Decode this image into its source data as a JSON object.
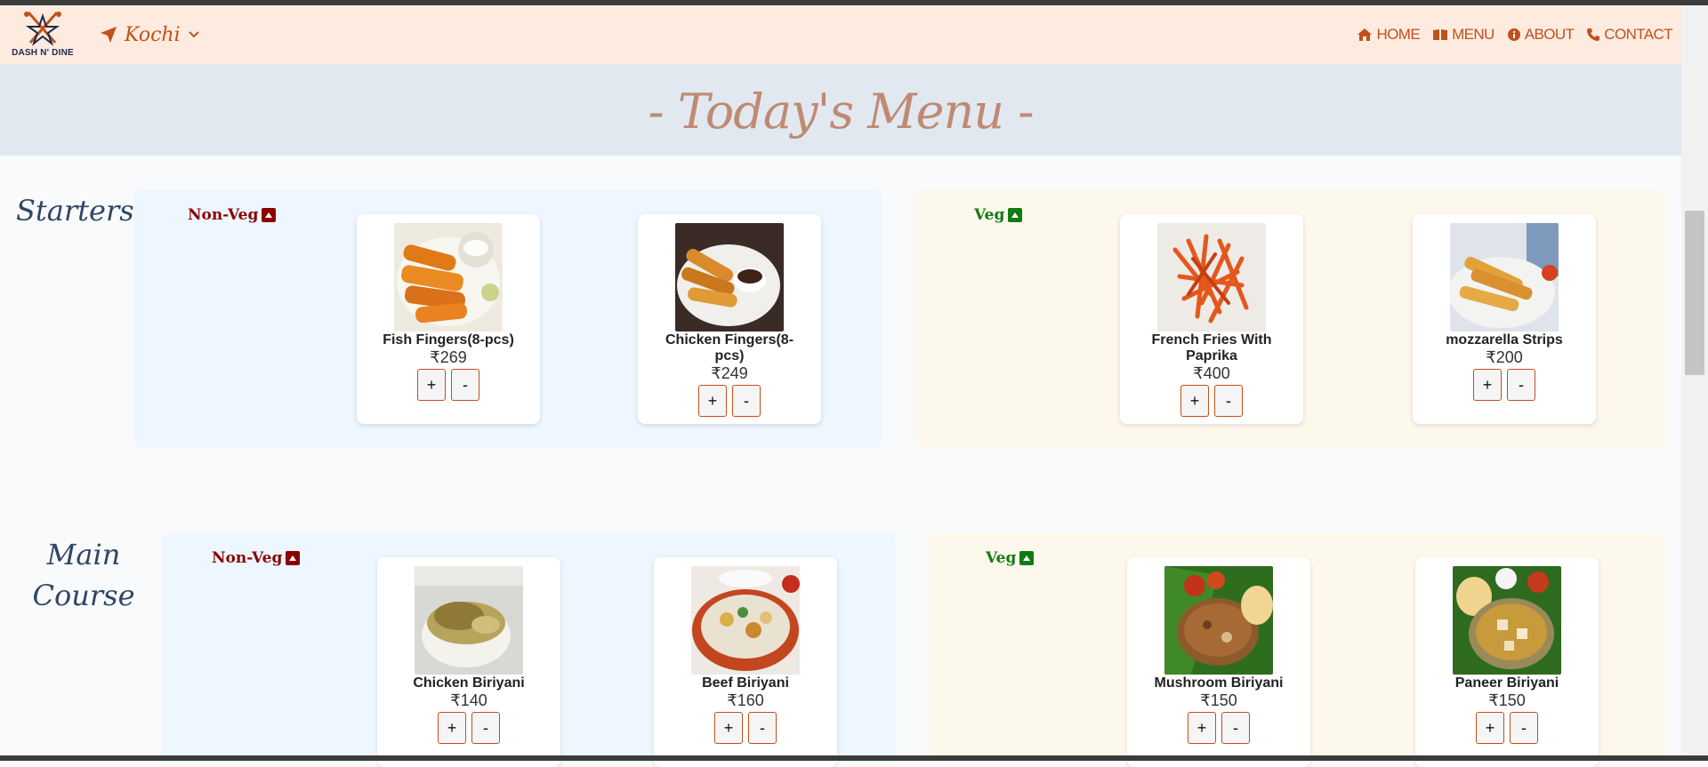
{
  "brand": {
    "logo_text": "DASH N' DINE"
  },
  "location": {
    "city": "Kochi"
  },
  "nav": {
    "home": "HOME",
    "menu": "MENU",
    "about": "ABOUT",
    "contact": "CONTACT"
  },
  "hero": {
    "title": "- Today's Menu -"
  },
  "sections": {
    "starters": {
      "title": "Starters",
      "nonveg": {
        "label": "Non-Veg",
        "items": [
          {
            "name": "Fish Fingers(8-pcs)",
            "price": "₹269"
          },
          {
            "name": "Chicken Fingers(8-pcs)",
            "price": "₹249"
          }
        ]
      },
      "veg": {
        "label": "Veg",
        "items": [
          {
            "name": "French Fries With Paprika",
            "price": "₹400"
          },
          {
            "name": "mozzarella Strips",
            "price": "₹200"
          }
        ]
      }
    },
    "main": {
      "title_line1": "Main",
      "title_line2": "Course",
      "nonveg": {
        "label": "Non-Veg",
        "items": [
          {
            "name": "Chicken Biriyani",
            "price": "₹140"
          },
          {
            "name": "Beef Biriyani",
            "price": "₹160"
          }
        ]
      },
      "veg": {
        "label": "Veg",
        "items": [
          {
            "name": "Mushroom Biriyani",
            "price": "₹150"
          },
          {
            "name": "Paneer Biriyani",
            "price": "₹150"
          }
        ]
      }
    }
  },
  "buttons": {
    "plus": "+",
    "minus": "-"
  },
  "colors": {
    "accent": "#c2501b",
    "nonveg": "#8b0000",
    "veg": "#137a13",
    "navbar": "#fdebe0"
  }
}
